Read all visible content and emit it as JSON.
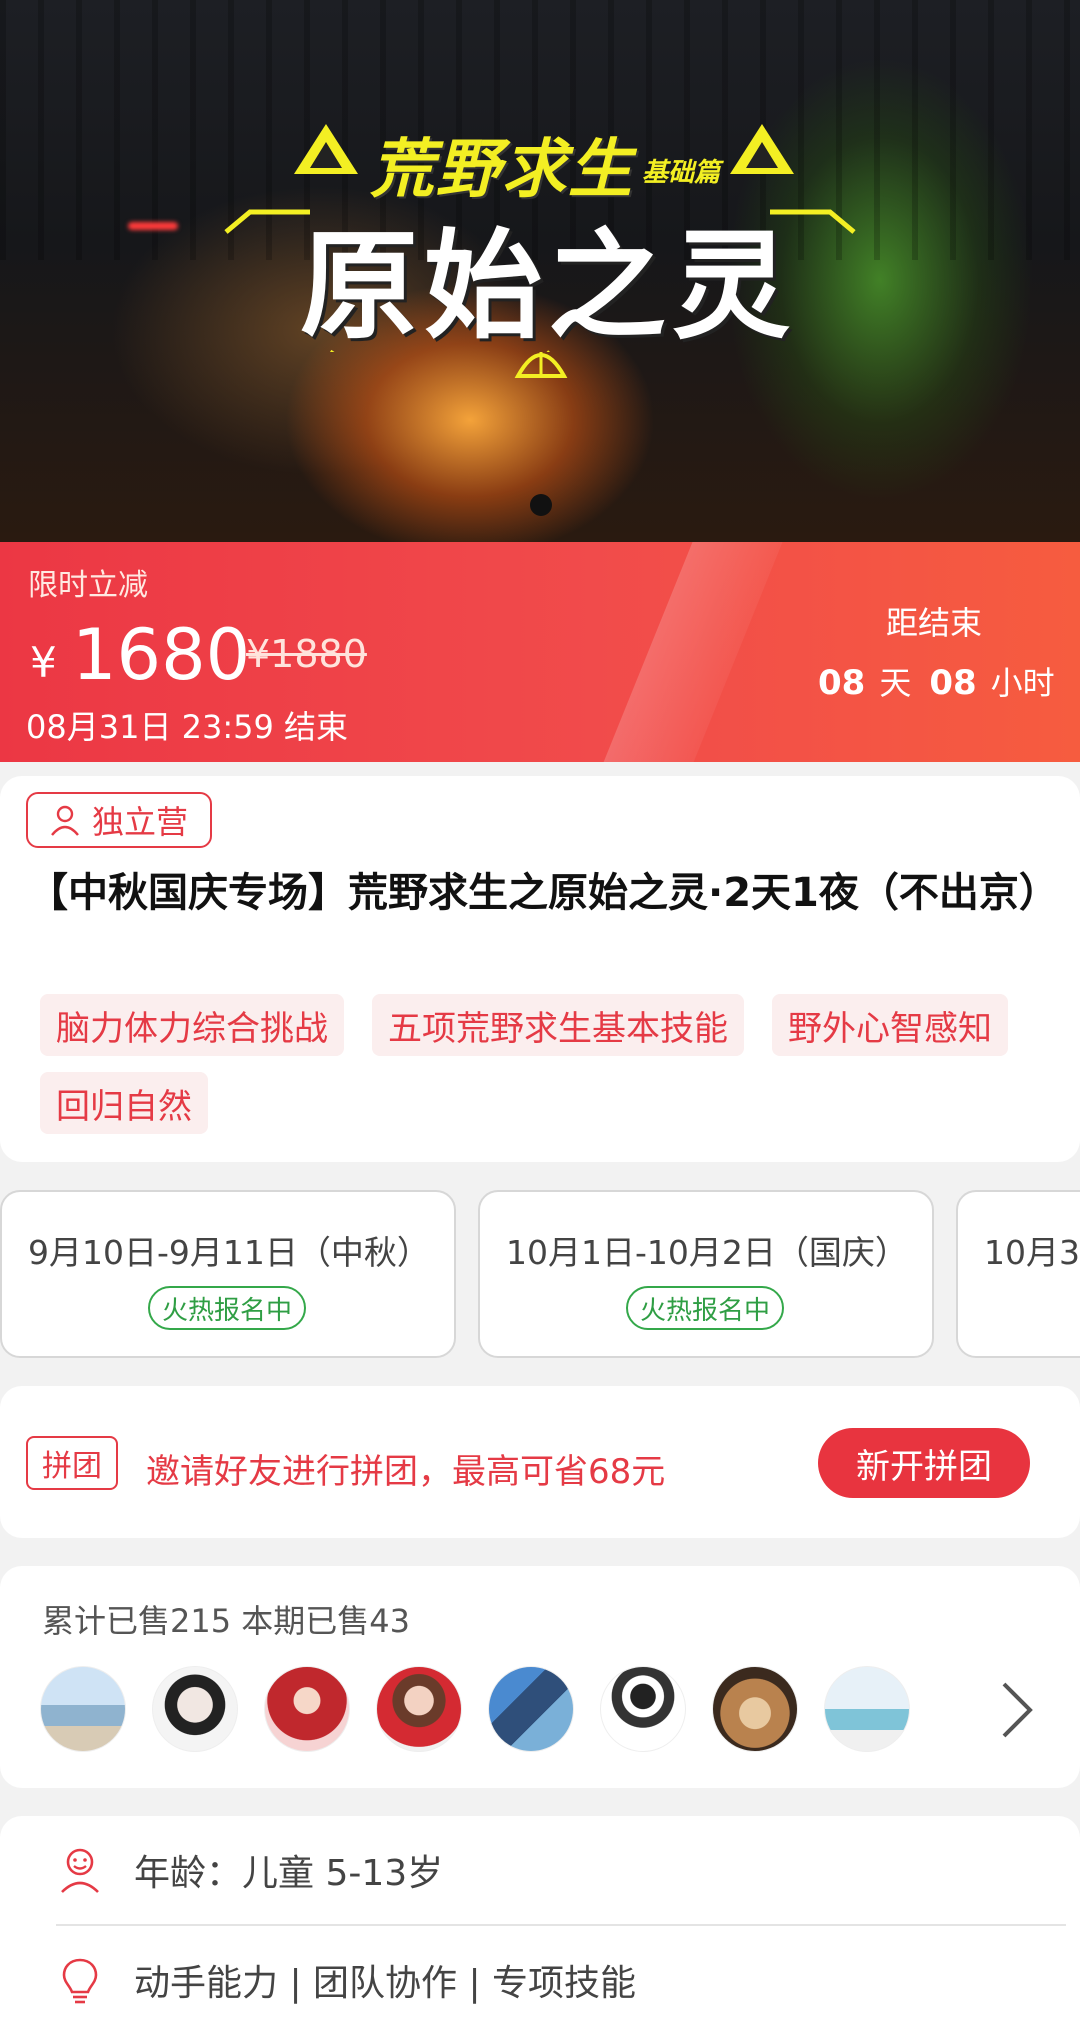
{
  "hero": {
    "title_main": "原始之灵",
    "title_sub": "荒野求生",
    "title_tag": "基础篇"
  },
  "promo": {
    "label": "限时立减",
    "currency": "¥",
    "price": "1680",
    "original_price": "¥1880",
    "end_time": "08月31日 23:59 结束",
    "countdown_label": "距结束",
    "countdown_days": "08",
    "days_unit": "天",
    "countdown_hours": "08",
    "hours_unit": "小时"
  },
  "product": {
    "badge": "独立营",
    "title": "【中秋国庆专场】荒野求生之原始之灵·2天1夜（不出京）",
    "tags": [
      "脑力体力综合挑战",
      "五项荒野求生基本技能",
      "野外心智感知",
      "回归自然"
    ]
  },
  "dates": [
    {
      "label": "9月10日-9月11日（中秋）",
      "status": "火热报名中"
    },
    {
      "label": "10月1日-10月2日（国庆）",
      "status": "火热报名中"
    },
    {
      "label": "10月3",
      "status": ""
    }
  ],
  "group_buy": {
    "badge": "拼团",
    "text": "邀请好友进行拼团，最高可省68元",
    "button": "新开拼团"
  },
  "sold": {
    "text": "累计已售215 本期已售43",
    "avatar_count": 8
  },
  "attributes": [
    {
      "icon": "smiley-icon",
      "text": "年龄：儿童 5-13岁"
    },
    {
      "icon": "lightbulb-icon",
      "text": "动手能力 | 团队协作 | 专项技能"
    }
  ],
  "colors": {
    "accent": "#e53a45",
    "promo_gradient_start": "#ec3744",
    "promo_gradient_end": "#f65c3f",
    "status_green": "#2f9e44",
    "title_yellow": "#f3ef23"
  }
}
